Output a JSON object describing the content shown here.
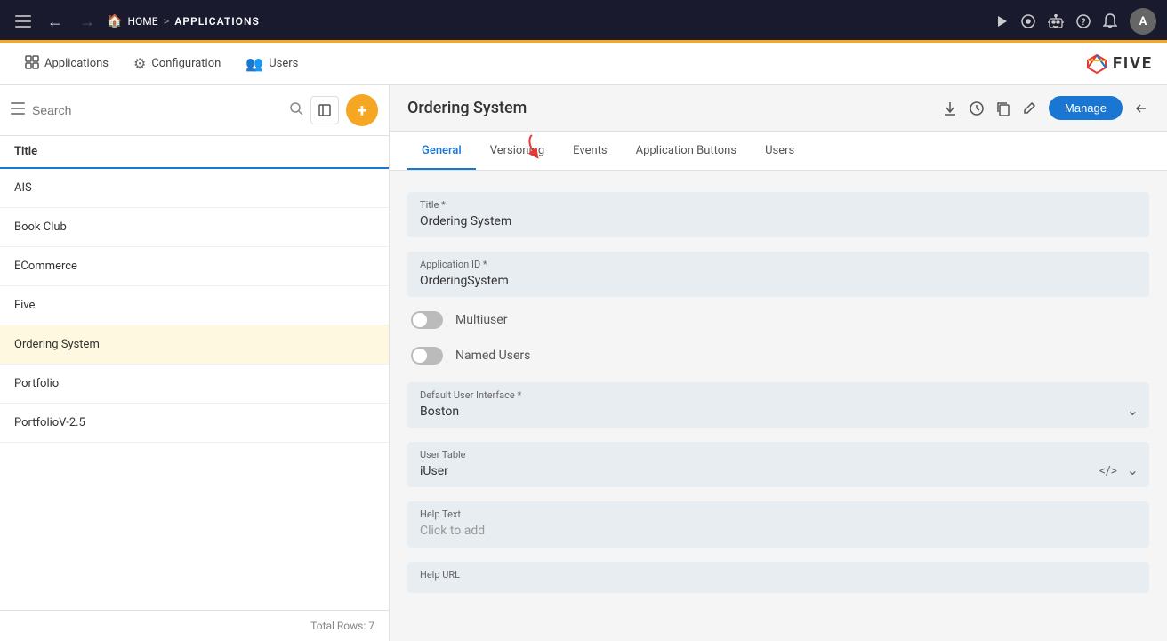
{
  "topNav": {
    "homeLabel": "HOME",
    "separator": ">",
    "currentPage": "APPLICATIONS",
    "avatarInitial": "A"
  },
  "secondaryNav": {
    "items": [
      {
        "id": "applications",
        "label": "Applications",
        "icon": "grid"
      },
      {
        "id": "configuration",
        "label": "Configuration",
        "icon": "settings"
      },
      {
        "id": "users",
        "label": "Users",
        "icon": "people"
      }
    ]
  },
  "sidebar": {
    "searchPlaceholder": "Search",
    "headerLabel": "Title",
    "items": [
      {
        "label": "AIS",
        "active": false
      },
      {
        "label": "Book Club",
        "active": false
      },
      {
        "label": "ECommerce",
        "active": false
      },
      {
        "label": "Five",
        "active": false
      },
      {
        "label": "Ordering System",
        "active": true
      },
      {
        "label": "Portfolio",
        "active": false
      },
      {
        "label": "PortfolioV-2.5",
        "active": false
      }
    ],
    "footerText": "Total Rows: 7"
  },
  "contentHeader": {
    "title": "Ordering System",
    "manageLabel": "Manage"
  },
  "tabs": [
    {
      "id": "general",
      "label": "General",
      "active": true
    },
    {
      "id": "versioning",
      "label": "Versioning",
      "active": false
    },
    {
      "id": "events",
      "label": "Events",
      "active": false
    },
    {
      "id": "applicationButtons",
      "label": "Application Buttons",
      "active": false
    },
    {
      "id": "users",
      "label": "Users",
      "active": false
    }
  ],
  "form": {
    "titleField": {
      "label": "Title *",
      "value": "Ordering System"
    },
    "applicationIdField": {
      "label": "Application ID *",
      "value": "OrderingSystem"
    },
    "multiuserToggle": {
      "label": "Multiuser",
      "enabled": false
    },
    "namedUsersToggle": {
      "label": "Named Users",
      "enabled": false
    },
    "defaultUIField": {
      "label": "Default User Interface *",
      "value": "Boston"
    },
    "userTableField": {
      "label": "User Table",
      "value": "iUser"
    },
    "helpTextField": {
      "label": "Help Text",
      "placeholder": "Click to add"
    },
    "helpUrlField": {
      "label": "Help URL",
      "value": ""
    }
  }
}
